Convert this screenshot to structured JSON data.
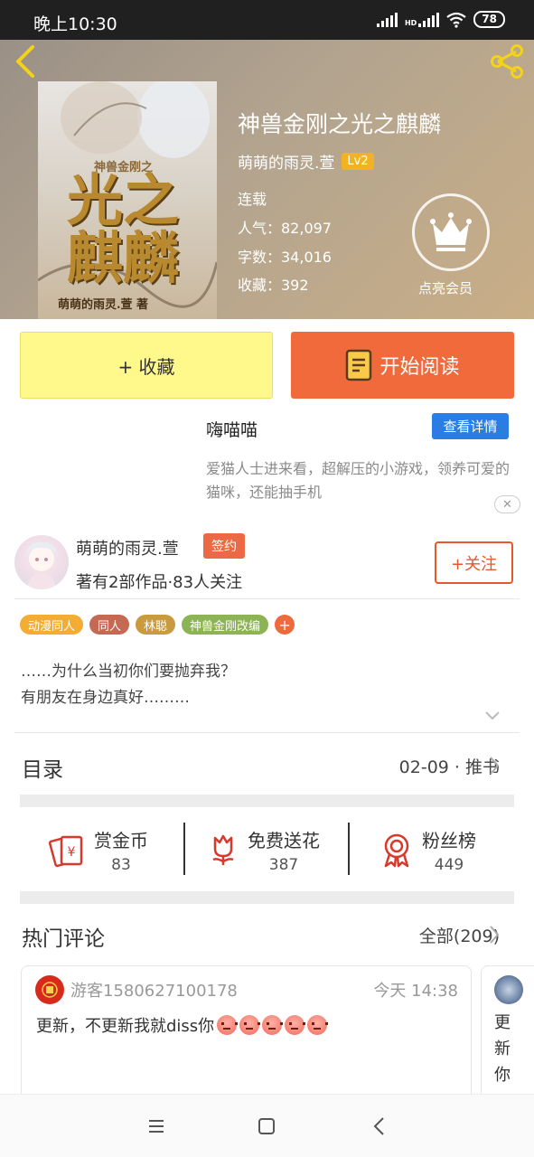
{
  "status_bar": {
    "time": "晚上10:30",
    "network": "HD",
    "battery": "78"
  },
  "book": {
    "cover_title": "光之麒麟",
    "cover_subtitle": "神兽金刚之",
    "cover_author": "萌萌的雨灵.萱 著",
    "title": "神兽金刚之光之麒麟",
    "author": "萌萌的雨灵.萱",
    "author_level": "Lv2",
    "status": "连载",
    "popularity": "人气：82,097",
    "word_count": "字数：34,016",
    "favorites": "收藏：392",
    "vip_label": "点亮会员"
  },
  "actions": {
    "favorite_label": "+ 收藏",
    "read_label": "开始阅读"
  },
  "ad": {
    "title": "嗨喵喵",
    "detail_label": "查看详情",
    "description": "爱猫人士进来看，超解压的小游戏，领养可爱的猫咪，还能抽手机",
    "close_label": "✕"
  },
  "author_section": {
    "name": "萌萌的雨灵.萱",
    "badge": "签约",
    "stats": "著有2部作品·83人关注",
    "follow_label": "+关注"
  },
  "tags": [
    {
      "label": "动漫同人",
      "color": "#f3ad35"
    },
    {
      "label": "同人",
      "color": "#c46a54"
    },
    {
      "label": "林聪",
      "color": "#c99a3e"
    },
    {
      "label": "神兽金刚改编",
      "color": "#8cb354"
    }
  ],
  "tag_add_label": "+",
  "synopsis": {
    "line1": "……为什么当初你们要抛弃我？",
    "line2": "有朋友在身边真好………"
  },
  "contents": {
    "title": "目录",
    "latest": "02-09 · 推书"
  },
  "stats": {
    "reward": {
      "label": "赏金币",
      "value": "83"
    },
    "flowers": {
      "label": "免费送花",
      "value": "387"
    },
    "fans": {
      "label": "粉丝榜",
      "value": "449"
    }
  },
  "comments": {
    "title": "热门评论",
    "all_label": "全部(209)",
    "first": {
      "user": "游客1580627100178",
      "time": "今天 14:38",
      "text": "更新，不更新我就diss你",
      "emoji_count": 5
    },
    "second_preview": "更新你"
  },
  "colors": {
    "accent_orange": "#f06a3c",
    "favorite_yellow": "#fff88a",
    "ad_blue": "#2a7de2"
  }
}
